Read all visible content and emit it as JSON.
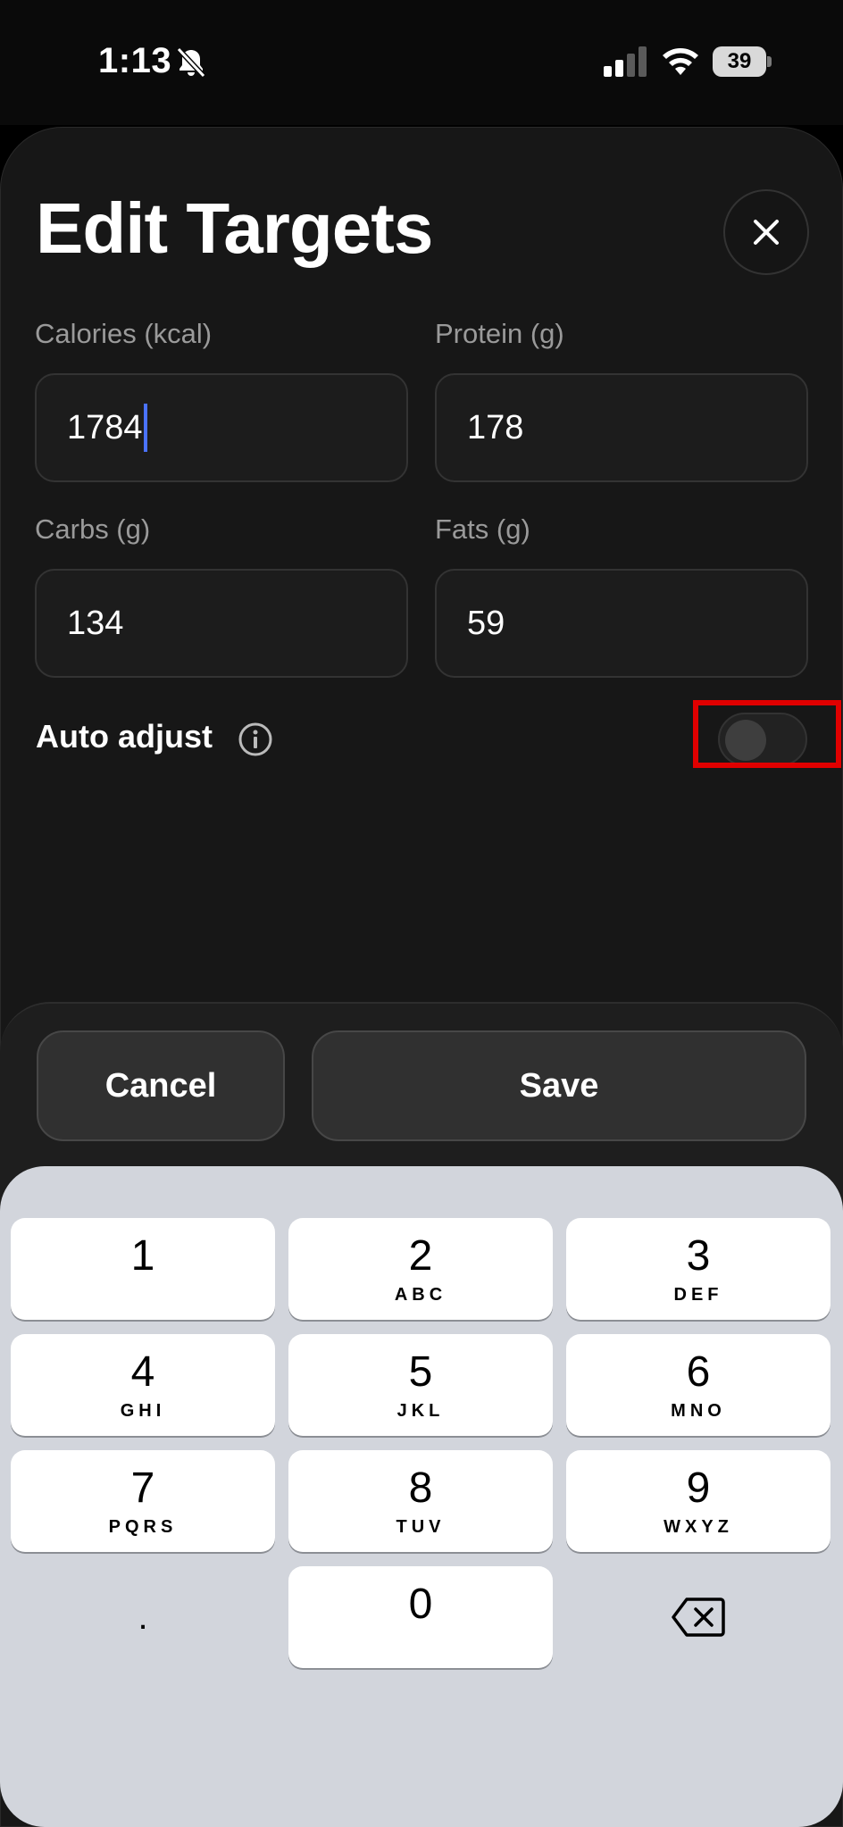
{
  "status_bar": {
    "time": "1:13",
    "battery_level": "39"
  },
  "sheet": {
    "title": "Edit Targets"
  },
  "fields": [
    {
      "label": "Calories (kcal)",
      "value": "1784"
    },
    {
      "label": "Protein (g)",
      "value": "178"
    },
    {
      "label": "Carbs (g)",
      "value": "134"
    },
    {
      "label": "Fats (g)",
      "value": "59"
    }
  ],
  "auto_adjust": {
    "label": "Auto adjust",
    "enabled": false
  },
  "actions": {
    "cancel_label": "Cancel",
    "save_label": "Save"
  },
  "keypad": {
    "keys": [
      {
        "num": "1",
        "letters": ""
      },
      {
        "num": "2",
        "letters": "ABC"
      },
      {
        "num": "3",
        "letters": "DEF"
      },
      {
        "num": "4",
        "letters": "GHI"
      },
      {
        "num": "5",
        "letters": "JKL"
      },
      {
        "num": "6",
        "letters": "MNO"
      },
      {
        "num": "7",
        "letters": "PQRS"
      },
      {
        "num": "8",
        "letters": "TUV"
      },
      {
        "num": "9",
        "letters": "WXYZ"
      },
      {
        "num": "0",
        "letters": ""
      }
    ],
    "decimal": "."
  },
  "icons": {
    "bell_off": "bell-slash-icon",
    "signal": "cellular-signal-icon",
    "wifi": "wifi-icon",
    "close": "close-icon",
    "info": "info-icon",
    "backspace": "backspace-icon"
  },
  "colors": {
    "caret": "#4a72ff",
    "highlight": "#e00000"
  }
}
